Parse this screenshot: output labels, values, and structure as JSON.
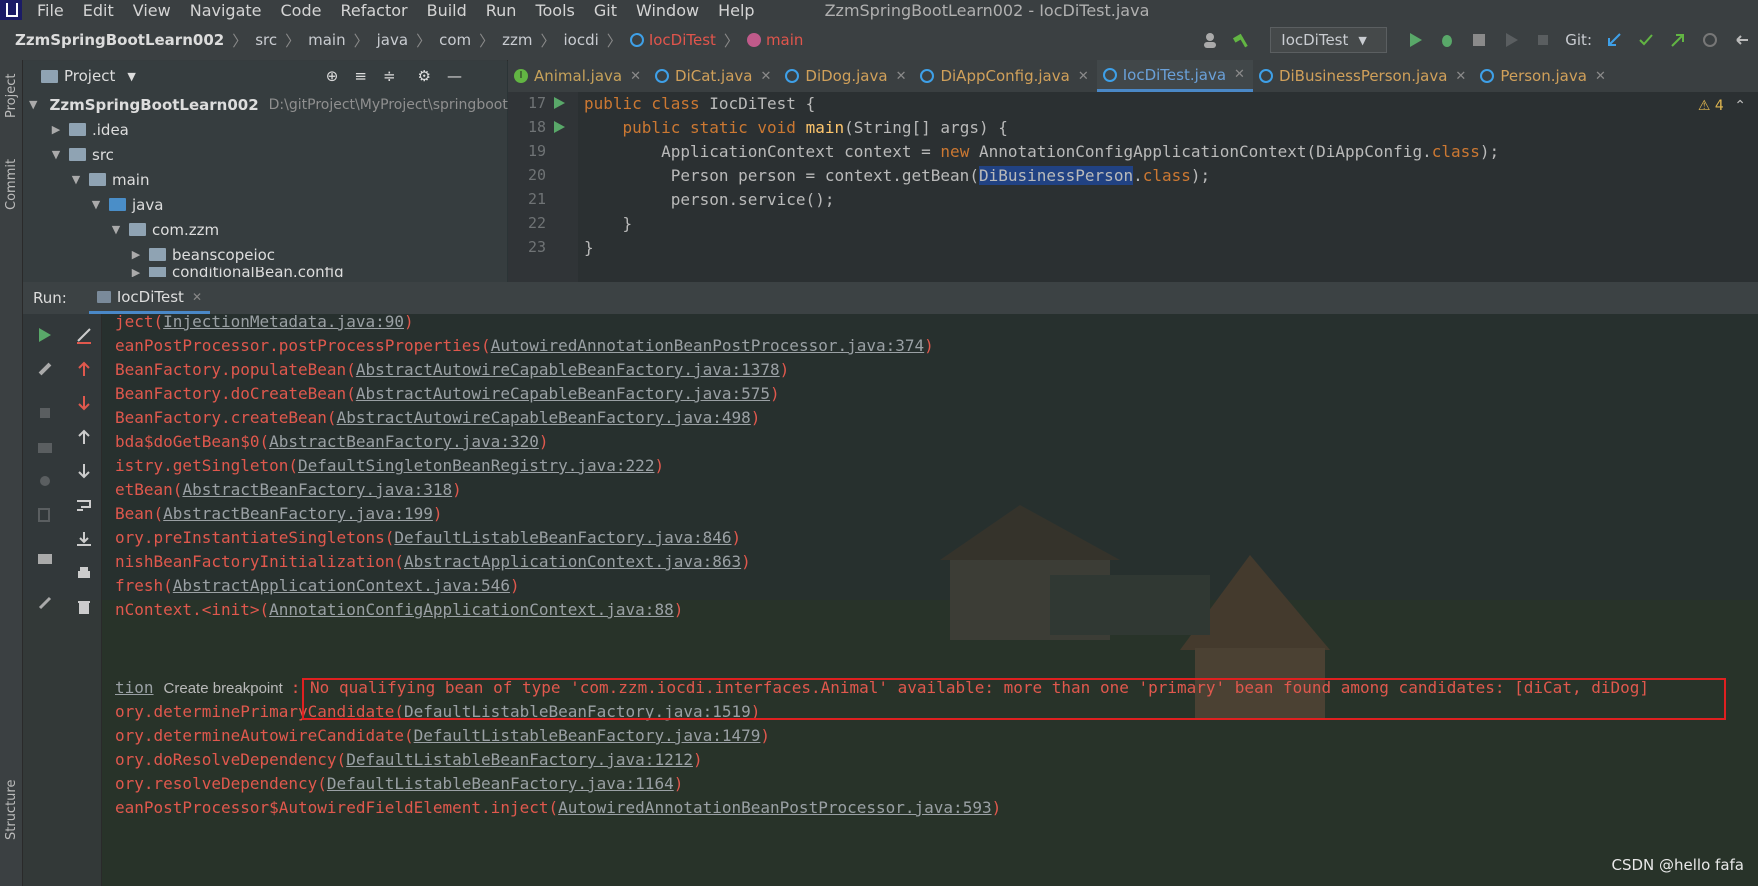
{
  "menu": {
    "items": [
      "File",
      "Edit",
      "View",
      "Navigate",
      "Code",
      "Refactor",
      "Build",
      "Run",
      "Tools",
      "Git",
      "Window",
      "Help"
    ],
    "window_title": "ZzmSpringBootLearn002 - IocDiTest.java"
  },
  "breadcrumb": {
    "items": [
      "ZzmSpringBootLearn002",
      "src",
      "main",
      "java",
      "com",
      "zzm",
      "iocdi",
      "IocDiTest",
      "main"
    ]
  },
  "toolbar": {
    "run_config": "IocDiTest",
    "git_label": "Git:"
  },
  "left_strip": {
    "project_label": "Project",
    "commit_label": "Commit",
    "structure_label": "Structure"
  },
  "project_panel": {
    "title": "Project",
    "root_name": "ZzmSpringBootLearn002",
    "root_path": "D:\\gitProject\\MyProject\\springboot",
    "nodes": [
      ".idea",
      "src",
      "main",
      "java",
      "com.zzm",
      "beanscopeioc",
      "conditionalBean.config"
    ]
  },
  "editor": {
    "tabs": [
      "Animal.java",
      "DiCat.java",
      "DiDog.java",
      "DiAppConfig.java",
      "IocDiTest.java",
      "DiBusinessPerson.java",
      "Person.java"
    ],
    "active_tab": "IocDiTest.java",
    "line_numbers": [
      "17",
      "18",
      "19",
      "20",
      "21",
      "22",
      "23"
    ],
    "warnings": "4",
    "code": {
      "l17_kw": "public class ",
      "l17_name": "IocDiTest {",
      "l18_kw": "    public static void ",
      "l18_fn": "main",
      "l18_rest": "(String[] args) {",
      "l19_a": "        ApplicationContext context = ",
      "l19_kw": "new",
      "l19_b": " AnnotationConfigApplicationContext(DiAppConfig.",
      "l19_cls": "class",
      "l19_c": ");",
      "l20_a": "         Person person = context.getBean(",
      "l20_sel": "DiBusinessPerson",
      "l20_b": ".",
      "l20_cls": "class",
      "l20_c": ");",
      "l21": "         person.service();",
      "l22": "    }",
      "l23": "}"
    }
  },
  "run_panel": {
    "label": "Run:",
    "tab": "IocDiTest",
    "trace": [
      {
        "pre": "ject(",
        "link": "InjectionMetadata.java:90",
        "post": ")"
      },
      {
        "pre": "eanPostProcessor.postProcessProperties(",
        "link": "AutowiredAnnotationBeanPostProcessor.java:374",
        "post": ")"
      },
      {
        "pre": "BeanFactory.populateBean(",
        "link": "AbstractAutowireCapableBeanFactory.java:1378",
        "post": ")"
      },
      {
        "pre": "BeanFactory.doCreateBean(",
        "link": "AbstractAutowireCapableBeanFactory.java:575",
        "post": ")"
      },
      {
        "pre": "BeanFactory.createBean(",
        "link": "AbstractAutowireCapableBeanFactory.java:498",
        "post": ")"
      },
      {
        "pre": "bda$doGetBean$0(",
        "link": "AbstractBeanFactory.java:320",
        "post": ")"
      },
      {
        "pre": "istry.getSingleton(",
        "link": "DefaultSingletonBeanRegistry.java:222",
        "post": ")"
      },
      {
        "pre": "etBean(",
        "link": "AbstractBeanFactory.java:318",
        "post": ")"
      },
      {
        "pre": "Bean(",
        "link": "AbstractBeanFactory.java:199",
        "post": ")"
      },
      {
        "pre": "ory.preInstantiateSingletons(",
        "link": "DefaultListableBeanFactory.java:846",
        "post": ")"
      },
      {
        "pre": "nishBeanFactoryInitialization(",
        "link": "AbstractApplicationContext.java:863",
        "post": ")"
      },
      {
        "pre": "fresh(",
        "link": "AbstractApplicationContext.java:546",
        "post": ")"
      },
      {
        "pre": "nContext.<init>(",
        "link": "AnnotationConfigApplicationContext.java:88",
        "post": ")"
      }
    ],
    "exception_link": "tion",
    "create_breakpoint": "Create breakpoint",
    "exception_message": ": No qualifying bean of type 'com.zzm.iocdi.interfaces.Animal' available: more than one 'primary' bean found among candidates: [diCat, diDog]",
    "trace2": [
      {
        "pre": "ory.determinePrimaryCandidate(",
        "link": "DefaultListableBeanFactory.java:1519",
        "post": ")"
      },
      {
        "pre": "ory.determineAutowireCandidate(",
        "link": "DefaultListableBeanFactory.java:1479",
        "post": ")"
      },
      {
        "pre": "ory.doResolveDependency(",
        "link": "DefaultListableBeanFactory.java:1212",
        "post": ")"
      },
      {
        "pre": "ory.resolveDependency(",
        "link": "DefaultListableBeanFactory.java:1164",
        "post": ")"
      },
      {
        "pre": "eanPostProcessor$AutowiredFieldElement.inject(",
        "link": "AutowiredAnnotationBeanPostProcessor.java:593",
        "post": ")"
      }
    ]
  },
  "watermark": "CSDN @hello fafa",
  "colors": {
    "error_text": "#e0584d",
    "highlight_box": "#e02020",
    "accent": "#4a88c7"
  }
}
